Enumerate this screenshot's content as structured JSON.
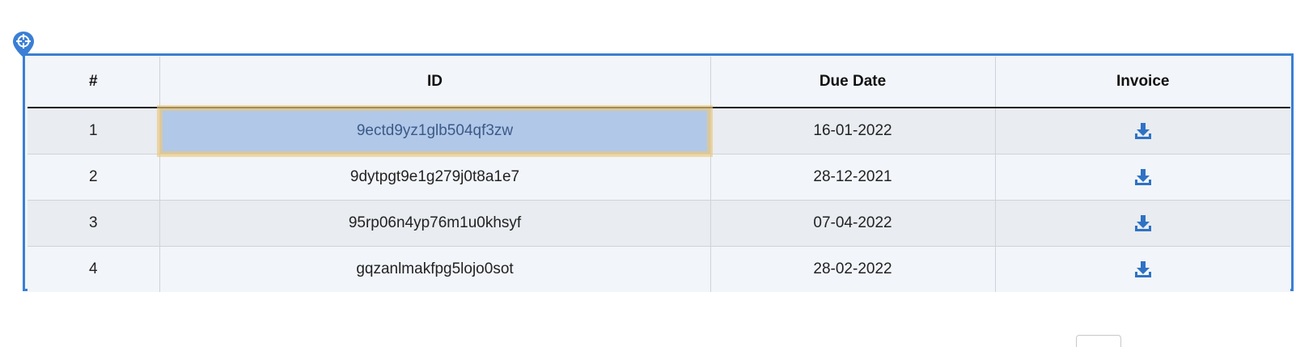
{
  "table": {
    "headers": {
      "num": "#",
      "id": "ID",
      "due_date": "Due Date",
      "invoice": "Invoice"
    },
    "rows": [
      {
        "num": "1",
        "id": "9ectd9yz1glb504qf3zw",
        "due_date": "16-01-2022",
        "invoice_icon": "download-icon",
        "selected": true
      },
      {
        "num": "2",
        "id": "9dytpgt9e1g279j0t8a1e7",
        "due_date": "28-12-2021",
        "invoice_icon": "download-icon"
      },
      {
        "num": "3",
        "id": "95rp06n4yp76m1u0khsyf",
        "due_date": "07-04-2022",
        "invoice_icon": "download-icon"
      },
      {
        "num": "4",
        "id": "gqzanlmakfpg5lojo0sot",
        "due_date": "28-02-2022",
        "invoice_icon": "download-icon"
      }
    ]
  },
  "locator_icon": "crosshair-pin-icon",
  "colors": {
    "frame_border": "#3a7fd5",
    "selected_cell_bg": "#b1c8e9",
    "selected_cell_outline": "#ecc878",
    "icon_blue": "#2f72c4"
  }
}
